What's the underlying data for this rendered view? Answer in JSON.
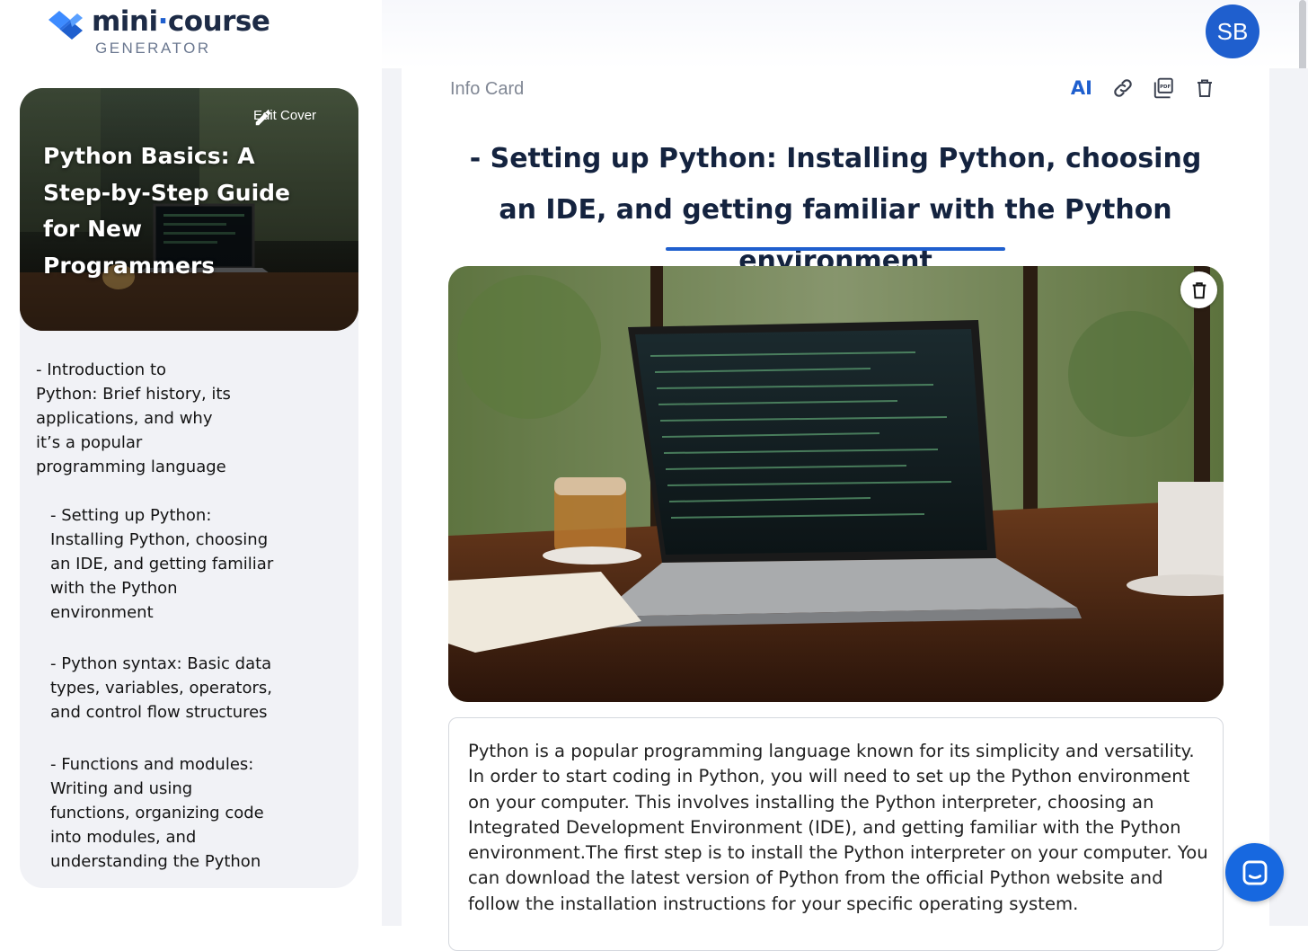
{
  "brand": {
    "name_part1": "mini",
    "name_dot": "·",
    "name_part2": "course",
    "tagline": "GENERATOR",
    "logo_icon": "logo-icon"
  },
  "user": {
    "initials": "SB"
  },
  "sidebar": {
    "cover": {
      "edit_label": "Edit Cover",
      "edit_icon": "pencil-icon",
      "title": "Python Basics: A Step-by-Step Guide for New Programmers"
    },
    "outline": [
      {
        "label": "- Introduction to\nPython: Brief history, its\napplications, and why\nit’s a popular\nprogramming language"
      },
      {
        "label": "- Setting up Python:\nInstalling Python, choosing\nan IDE, and getting familiar\nwith the Python\nenvironment"
      },
      {
        "label": "- Python syntax: Basic data\ntypes, variables, operators,\nand control flow structures"
      },
      {
        "label": "- Functions and modules:\nWriting and using\nfunctions, organizing code\ninto modules, and\nunderstanding the Python"
      }
    ]
  },
  "card": {
    "label": "Info Card",
    "tools": {
      "ai_label": "AI",
      "link_icon": "link-icon",
      "pdf_icon": "pdf-icon",
      "delete_icon": "trash-icon"
    },
    "heading": "- Setting up Python: Installing Python, choosing an IDE, and getting familiar with the Python environment",
    "image_delete_icon": "trash-icon",
    "body": "Python is a popular programming language known for its simplicity and versatility. In order to start coding in Python, you will need to set up the Python environment on your computer. This involves installing the Python interpreter, choosing an Integrated Development Environment (IDE), and getting familiar with the Python environment.The first step is to install the Python interpreter on your computer. You can download the latest version of Python from the official Python website and follow the installation instructions for your specific operating system."
  },
  "chat": {
    "icon": "chat-icon"
  },
  "colors": {
    "accent": "#1f5fce",
    "heading": "#14233f",
    "sidebar_bg": "#f1f2f6",
    "chat_button": "#1768e0"
  }
}
